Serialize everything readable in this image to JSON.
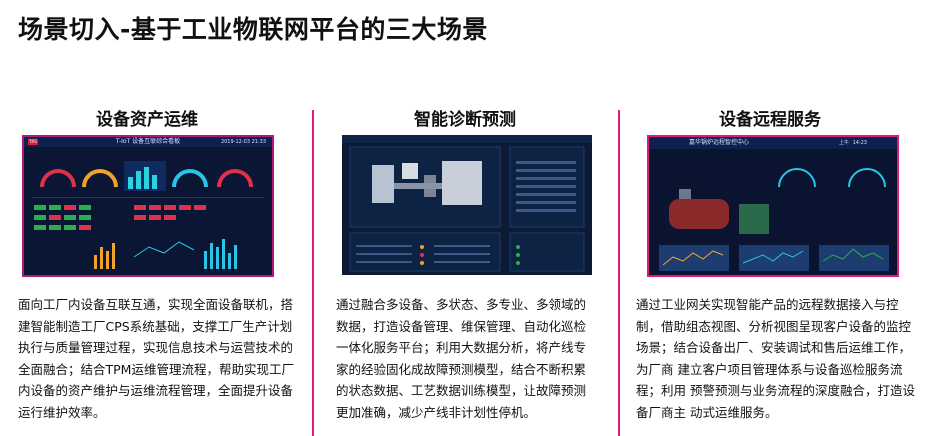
{
  "header": {
    "title": "场景切入-基于工业物联网平台的三大场景"
  },
  "columns": [
    {
      "title": "设备资产运维",
      "screenshot": {
        "logo": "TRS",
        "title": "T-IoT 设备互联综合看板",
        "clock": "2019-12-03 21:33"
      },
      "description": "面向工厂内设备互联互通，实现全面设备联机，搭建智能制造工厂CPS系统基础，支撑工厂生产计划执行与质量管理过程，实现信息技术与运营技术的全面融合；结合TPM运维管理流程，帮助实现工厂内设备的资产维护与运维流程管理，全面提升设备运行维护效率。"
    },
    {
      "title": "智能诊断预测",
      "screenshot": {
        "title": "工艺流程",
        "panel_left": "报警信息",
        "panel_right": "报警趋势"
      },
      "description": "通过融合多设备、多状态、多专业、多领域的数据，打造设备管理、维保管理、自动化巡检一体化服务平台；利用大数据分析，将产线专家的经验固化成故障预测模型，结合不断积累的状态数据、工艺数据训练模型，让故障预测更加准确，减少产线非计划性停机。"
    },
    {
      "title": "设备远程服务",
      "screenshot": {
        "title": "嘉华锅炉远程智控中心",
        "time": "14:23",
        "ampm": "上午"
      },
      "description": "通过工业网关实现智能产品的远程数据接入与控制，借助组态视图、分析视图呈现客户设备的监控场景；结合设备出厂、安装调试和售后运维工作，为厂商 建立客户项目管理体系与设备巡检服务流程；利用 预警预测与业务流程的深度融合，打造设备厂商主 动式运维服务。"
    }
  ],
  "colors": {
    "accent": "#e0197a",
    "screen_bg": "#0a1633"
  }
}
